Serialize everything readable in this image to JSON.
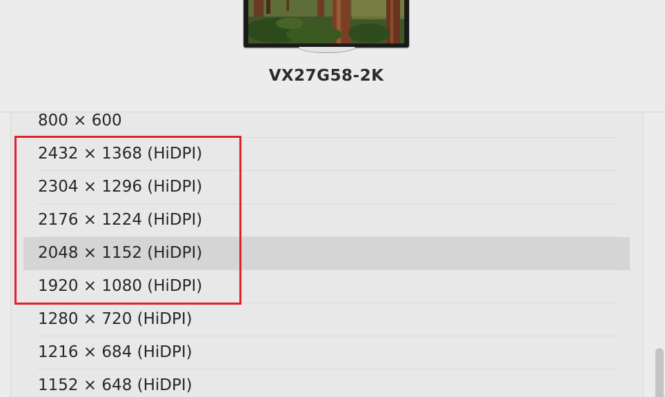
{
  "display": {
    "name": "VX27G58-2K",
    "preview_icon": "monitor-forest-wallpaper-icon"
  },
  "resolutions": [
    {
      "label": "800 × 600",
      "selected": false
    },
    {
      "label": "2432 × 1368 (HiDPI)",
      "selected": false
    },
    {
      "label": "2304 × 1296 (HiDPI)",
      "selected": false
    },
    {
      "label": "2176 × 1224 (HiDPI)",
      "selected": false
    },
    {
      "label": "2048 × 1152 (HiDPI)",
      "selected": true
    },
    {
      "label": "1920 × 1080 (HiDPI)",
      "selected": false
    },
    {
      "label": "1280 × 720 (HiDPI)",
      "selected": false
    },
    {
      "label": "1216 × 684 (HiDPI)",
      "selected": false
    },
    {
      "label": "1152 × 648 (HiDPI)",
      "selected": false
    }
  ],
  "colors": {
    "annotation_box": "#e0202a",
    "selected_row": "#d5d5d5",
    "background": "#ececec"
  }
}
